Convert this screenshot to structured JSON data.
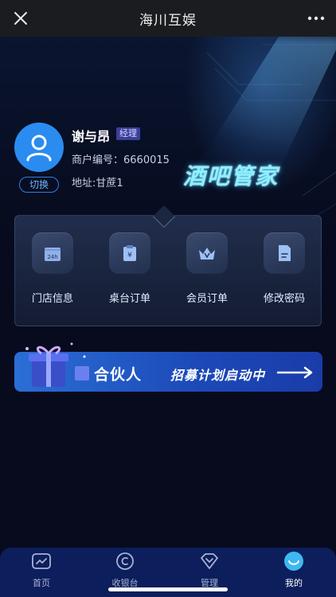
{
  "header": {
    "title": "海川互娱"
  },
  "profile": {
    "name": "谢与昂",
    "role": "经理",
    "merchant_no": "商户编号：6660015",
    "address": "地址:甘蔗1",
    "switch_label": "切换"
  },
  "brand": {
    "title": "酒吧管家"
  },
  "menu": {
    "items": [
      {
        "label": "门店信息",
        "icon": "store-24h-icon"
      },
      {
        "label": "桌台订单",
        "icon": "table-order-icon"
      },
      {
        "label": "会员订单",
        "icon": "crown-icon"
      },
      {
        "label": "修改密码",
        "icon": "document-icon"
      }
    ]
  },
  "banner": {
    "partner": "合伙人",
    "recruit": "招募计划启动中"
  },
  "tabbar": {
    "items": [
      {
        "label": "首页",
        "icon": "home-icon",
        "active": false
      },
      {
        "label": "收银台",
        "icon": "cashier-icon",
        "active": false
      },
      {
        "label": "管理",
        "icon": "manage-icon",
        "active": false
      },
      {
        "label": "我的",
        "icon": "profile-icon",
        "active": true
      }
    ]
  },
  "colors": {
    "accent": "#2a8cf0",
    "background": "#070b1d",
    "tabbar": "#0c1e5c"
  }
}
